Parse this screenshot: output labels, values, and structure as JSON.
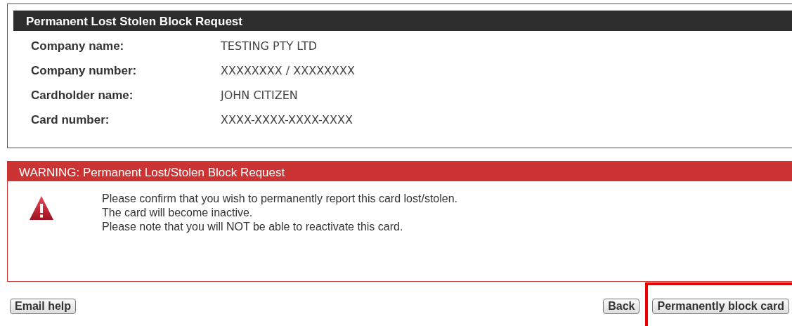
{
  "details_panel": {
    "title": "Permanent Lost Stolen Block Request",
    "fields": [
      {
        "label": "Company name:",
        "value": "TESTING PTY LTD"
      },
      {
        "label": "Company number:",
        "value": "XXXXXXXX / XXXXXXXX"
      },
      {
        "label": "Cardholder name:",
        "value": "JOHN CITIZEN"
      },
      {
        "label": "Card number:",
        "value": "XXXX-XXXX-XXXX-XXXX"
      }
    ]
  },
  "warning_panel": {
    "title": "WARNING: Permanent Lost/Stolen Block Request",
    "lines": [
      "Please confirm that you wish to permanently report this card lost/stolen.",
      "The card will become inactive.",
      "Please note that you will NOT be able to reactivate this card."
    ]
  },
  "left_buttons": [
    {
      "label": "Email help",
      "highlighted": false
    }
  ],
  "right_buttons": [
    {
      "label": "Back",
      "highlighted": false
    },
    {
      "label": "Permanently block card",
      "highlighted": true
    }
  ]
}
